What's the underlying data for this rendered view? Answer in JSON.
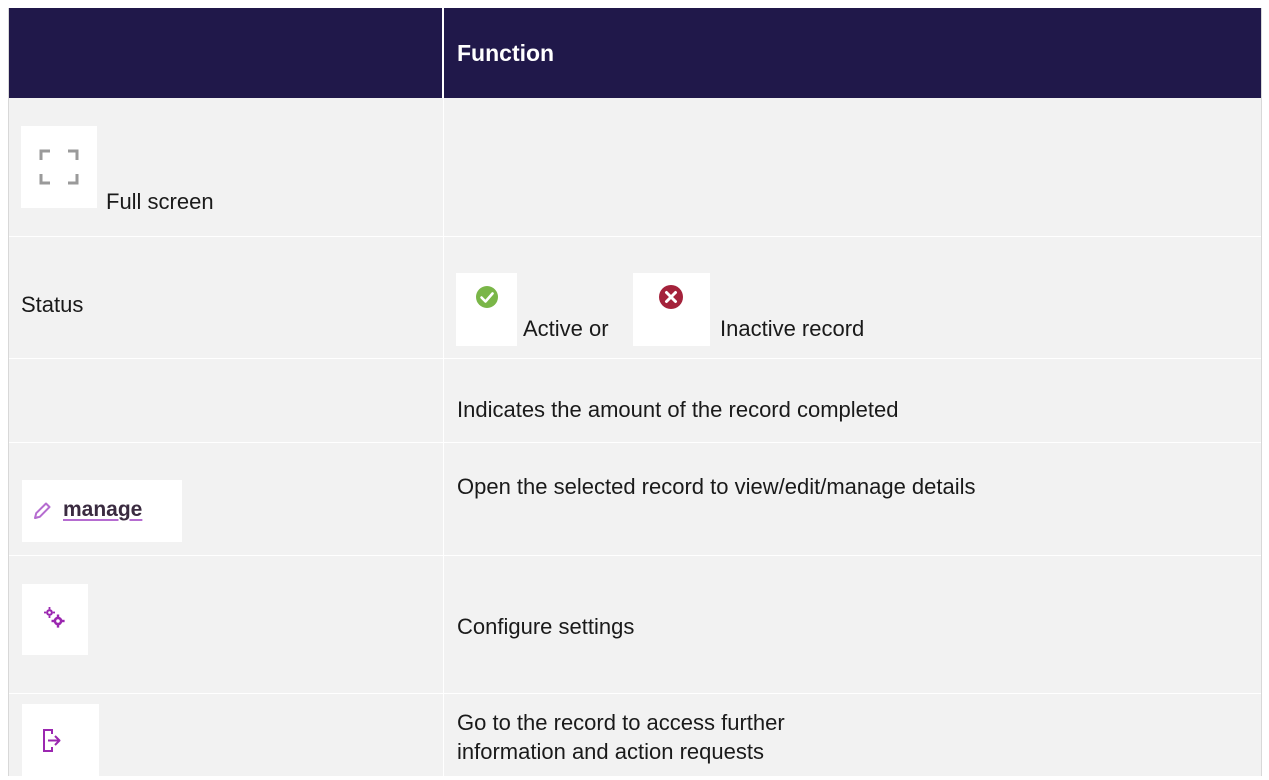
{
  "header": {
    "col1": "",
    "col2": "Function"
  },
  "rows": [
    {
      "icon": "fullscreen-icon",
      "col1_text": "Full screen",
      "col2_text": ""
    },
    {
      "col1_text": "Status",
      "active_icon": "check-circle-icon",
      "active_text": "Active or",
      "inactive_icon": "x-circle-icon",
      "inactive_text": "Inactive record"
    },
    {
      "col1_text": "",
      "col2_text": "Indicates the amount of the record completed"
    },
    {
      "icon": "pencil-icon",
      "col1_link": "manage",
      "col2_text": "Open the selected record to view/edit/manage details"
    },
    {
      "icon": "gears-icon",
      "col2_text": "Configure settings"
    },
    {
      "icon": "exit-arrow-icon",
      "col2_text": "Go to the record to access further information and action requests"
    }
  ],
  "colors": {
    "header_bg": "#20184a",
    "row_bg": "#f2f2f2",
    "active_green": "#7ab648",
    "inactive_red": "#a4223b",
    "accent_purple": "#9b27b0"
  }
}
